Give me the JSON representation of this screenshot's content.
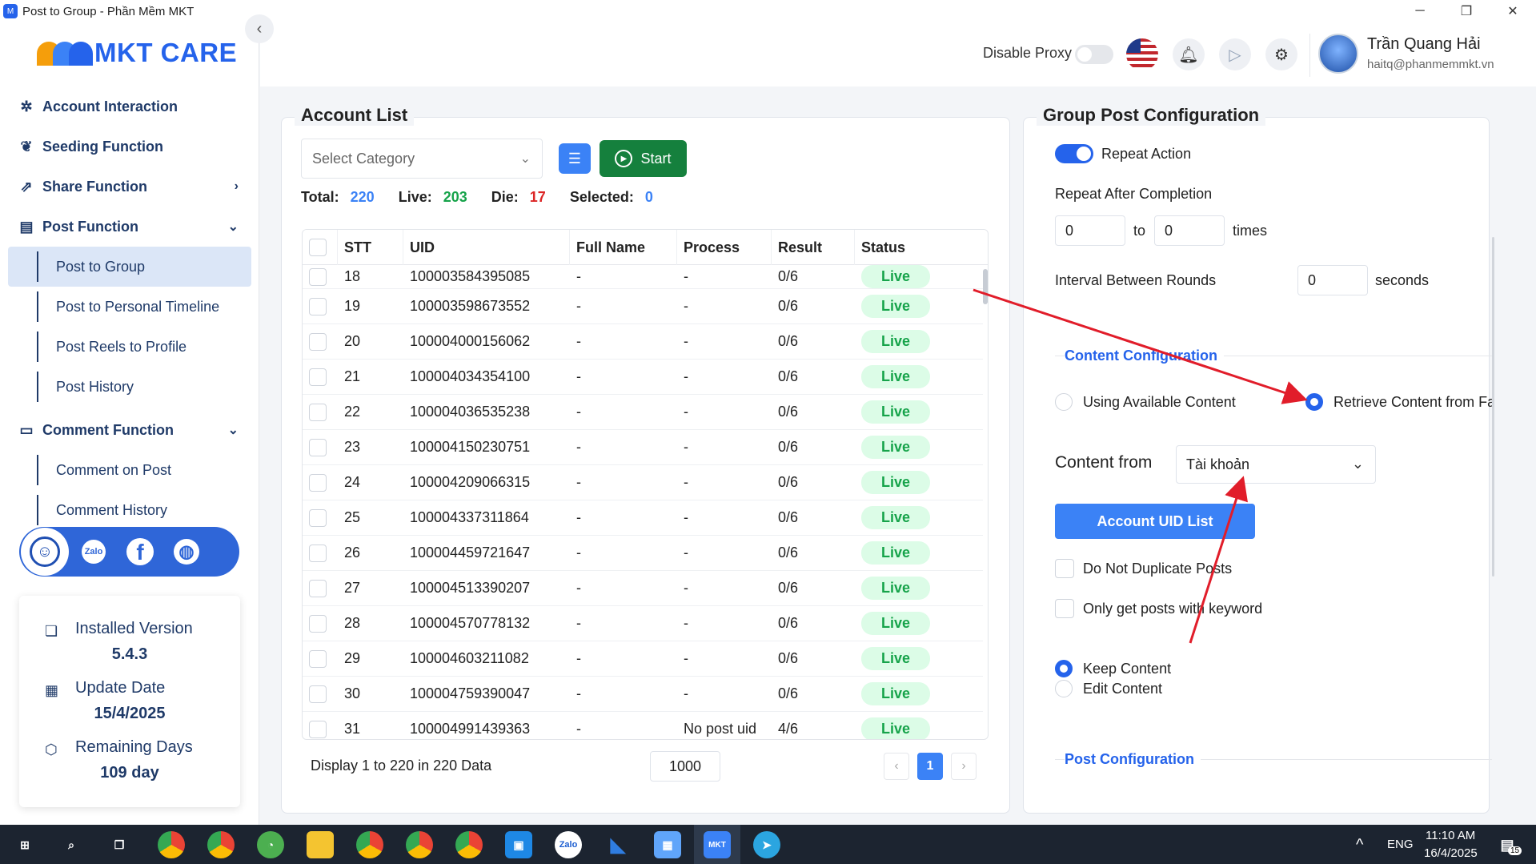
{
  "window": {
    "title": "Post to Group - Phần Mềm MKT",
    "controls": [
      "minimize",
      "restore",
      "close"
    ]
  },
  "logo": {
    "text": "MKT CARE"
  },
  "sidebar": {
    "items": [
      {
        "label": "Account Interaction",
        "icon": "sparkle-icon"
      },
      {
        "label": "Seeding Function",
        "icon": "seed-icon"
      },
      {
        "label": "Share Function",
        "icon": "share-icon"
      },
      {
        "label": "Post Function",
        "icon": "post-icon"
      }
    ],
    "post_sub": [
      "Post to Group",
      "Post to Personal Timeline",
      "Post Reels to Profile",
      "Post History"
    ],
    "comment_label": "Comment Function",
    "comment_sub": [
      "Comment on Post",
      "Comment History"
    ],
    "socials": [
      "support-icon",
      "zalo-icon",
      "facebook-icon",
      "globe-icon"
    ],
    "zalo_text": "Zalo"
  },
  "version": {
    "installed_label": "Installed Version",
    "installed_value": "5.4.3",
    "update_label": "Update Date",
    "update_value": "15/4/2025",
    "remaining_label": "Remaining Days",
    "remaining_value": "109 day"
  },
  "header": {
    "proxy_label": "Disable Proxy",
    "proxy_on": false,
    "user_name": "Trần Quang Hải",
    "user_email": "haitq@phanmemmkt.vn"
  },
  "account_list": {
    "title": "Account List",
    "category_placeholder": "Select Category",
    "start_label": "Start",
    "stats": {
      "total_label": "Total:",
      "total": "220",
      "live_label": "Live:",
      "live": "203",
      "die_label": "Die:",
      "die": "17",
      "selected_label": "Selected:",
      "selected": "0"
    },
    "columns": [
      "STT",
      "UID",
      "Full Name",
      "Process",
      "Result",
      "Status"
    ],
    "rows": [
      {
        "stt": "18",
        "uid": "100003584395085",
        "name": "-",
        "process": "-",
        "result": "0/6",
        "status": "Live"
      },
      {
        "stt": "19",
        "uid": "100003598673552",
        "name": "-",
        "process": "-",
        "result": "0/6",
        "status": "Live"
      },
      {
        "stt": "20",
        "uid": "100004000156062",
        "name": "-",
        "process": "-",
        "result": "0/6",
        "status": "Live"
      },
      {
        "stt": "21",
        "uid": "100004034354100",
        "name": "-",
        "process": "-",
        "result": "0/6",
        "status": "Live"
      },
      {
        "stt": "22",
        "uid": "100004036535238",
        "name": "-",
        "process": "-",
        "result": "0/6",
        "status": "Live"
      },
      {
        "stt": "23",
        "uid": "100004150230751",
        "name": "-",
        "process": "-",
        "result": "0/6",
        "status": "Live"
      },
      {
        "stt": "24",
        "uid": "100004209066315",
        "name": "-",
        "process": "-",
        "result": "0/6",
        "status": "Live"
      },
      {
        "stt": "25",
        "uid": "100004337311864",
        "name": "-",
        "process": "-",
        "result": "0/6",
        "status": "Live"
      },
      {
        "stt": "26",
        "uid": "100004459721647",
        "name": "-",
        "process": "-",
        "result": "0/6",
        "status": "Live"
      },
      {
        "stt": "27",
        "uid": "100004513390207",
        "name": "-",
        "process": "-",
        "result": "0/6",
        "status": "Live"
      },
      {
        "stt": "28",
        "uid": "100004570778132",
        "name": "-",
        "process": "-",
        "result": "0/6",
        "status": "Live"
      },
      {
        "stt": "29",
        "uid": "100004603211082",
        "name": "-",
        "process": "-",
        "result": "0/6",
        "status": "Live"
      },
      {
        "stt": "30",
        "uid": "100004759390047",
        "name": "-",
        "process": "-",
        "result": "0/6",
        "status": "Live"
      },
      {
        "stt": "31",
        "uid": "100004991439363",
        "name": "-",
        "process": "No post uid",
        "result": "4/6",
        "status": "Live"
      }
    ],
    "footer": "Display 1 to 220 in 220 Data",
    "page_size": "1000",
    "page": "1",
    "prev": "‹",
    "next": "›"
  },
  "config": {
    "title": "Group Post Configuration",
    "repeat_label": "Repeat Action",
    "repeat_on": true,
    "repeat_after_label": "Repeat After Completion",
    "repeat_from": "0",
    "to_label": "to",
    "repeat_to": "0",
    "times_label": "times",
    "interval_label": "Interval Between Rounds",
    "interval": "0",
    "seconds_label": "seconds",
    "content_section": "Content Configuration",
    "using_label": "Using Available Content",
    "retrieve_label": "Retrieve Content from Fa",
    "content_from_label": "Content from",
    "content_from_value": "Tài khoản",
    "uid_button": "Account UID List",
    "no_dup_label": "Do Not Duplicate Posts",
    "keyword_label": "Only get posts with keyword",
    "keep_label": "Keep Content",
    "edit_label": "Edit Content",
    "post_section": "Post Configuration"
  },
  "taskbar": {
    "lang": "ENG",
    "time": "11:10 AM",
    "date": "16/4/2025",
    "notif_count": "15"
  },
  "colors": {
    "accent": "#2563eb",
    "live_bg": "#dcfce7",
    "live_text": "#16a34a",
    "die": "#dc2626",
    "start": "#15803d",
    "annotation_arrow": "#e11d2a"
  }
}
